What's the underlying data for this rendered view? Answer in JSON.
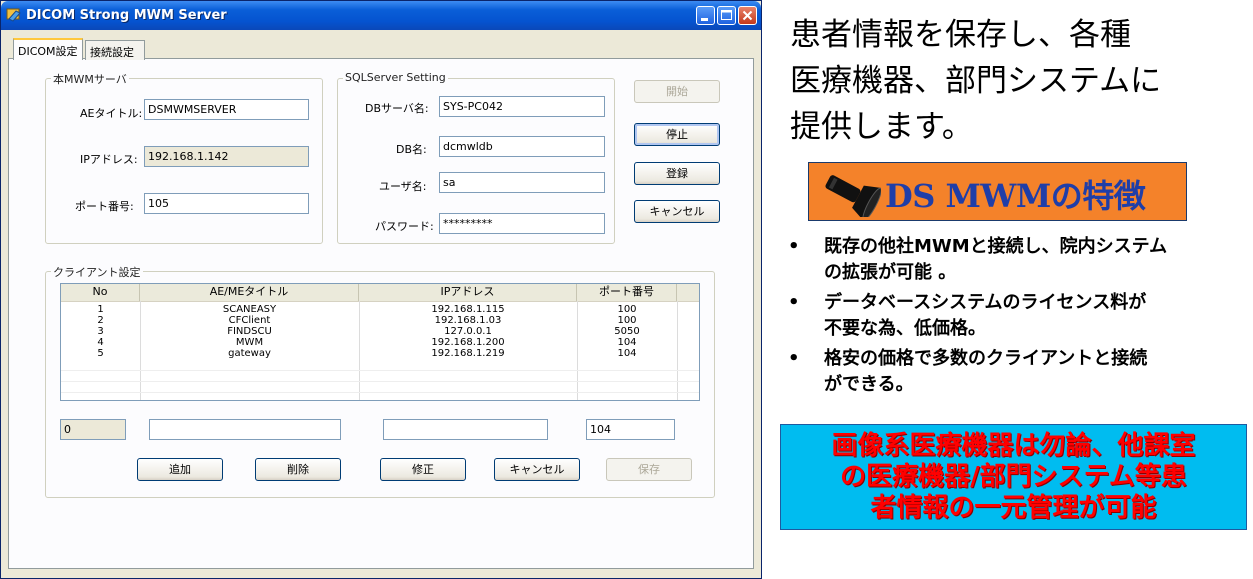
{
  "window": {
    "title": "DICOM Strong MWM Server",
    "tabs": [
      "DICOM設定",
      "接続設定"
    ],
    "colors": {
      "titlebar": "#0553d0",
      "face": "#ece9d8"
    }
  },
  "mwm_server": {
    "legend": "本MWMサーバ",
    "ae_title_label": "AEタイトル:",
    "ae_title_value": "DSMWMSERVER",
    "ip_label": "IPアドレス:",
    "ip_value": "192.168.1.142",
    "port_label": "ポート番号:",
    "port_value": "105"
  },
  "sql_settings": {
    "legend": "SQLServer Setting",
    "db_server_label": "DBサーバ名:",
    "db_server_value": "SYS-PC042",
    "db_name_label": "DB名:",
    "db_name_value": "dcmwldb",
    "user_label": "ユーザ名:",
    "user_value": "sa",
    "password_label": "パスワード:",
    "password_value": "*********"
  },
  "side_buttons": {
    "start": "開始",
    "stop": "停止",
    "register": "登録",
    "cancel": "キャンセル"
  },
  "clients": {
    "legend": "クライアント設定",
    "columns": [
      "No",
      "AE/MEタイトル",
      "IPアドレス",
      "ポート番号"
    ],
    "rows": [
      [
        "1",
        "SCANEASY",
        "192.168.1.115",
        "100"
      ],
      [
        "2",
        "CFClient",
        "192.168.1.03",
        "100"
      ],
      [
        "3",
        "FINDSCU",
        "127.0.0.1",
        "5050"
      ],
      [
        "4",
        "MWM",
        "192.168.1.200",
        "104"
      ],
      [
        "5",
        "gateway",
        "192.168.1.219",
        "104"
      ]
    ],
    "edit_no": "0",
    "edit_ae": "",
    "edit_ip": "",
    "edit_port": "104",
    "buttons": {
      "add": "追加",
      "delete": "削除",
      "modify": "修正",
      "cancel": "キャンセル",
      "save": "保存"
    }
  },
  "slide": {
    "intro_lines": [
      " 患者情報を保存し、各種",
      "医療機器、部門システムに",
      "提供します。"
    ],
    "banner": "DS MWMの特徴",
    "bullet_symbol": "•",
    "bullets": [
      [
        "既存の他社MWMと接続し、院内システム",
        "の拡張が可能 。"
      ],
      [
        "データベースシステムのライセンス料が",
        "不要な為、低価格。"
      ],
      [
        "格安の価格で多数のクライアントと接続",
        "ができる。"
      ]
    ],
    "highlight_lines": [
      "画像系医療機器は勿論、他課室",
      "の医療機器/部門システム等患",
      "者情報の一元管理が可能"
    ],
    "colors": {
      "banner_bg": "#f4822a",
      "banner_text": "#1f3ea8",
      "highlight_bg": "#00bcf0",
      "highlight_text": "#ff0000"
    }
  }
}
